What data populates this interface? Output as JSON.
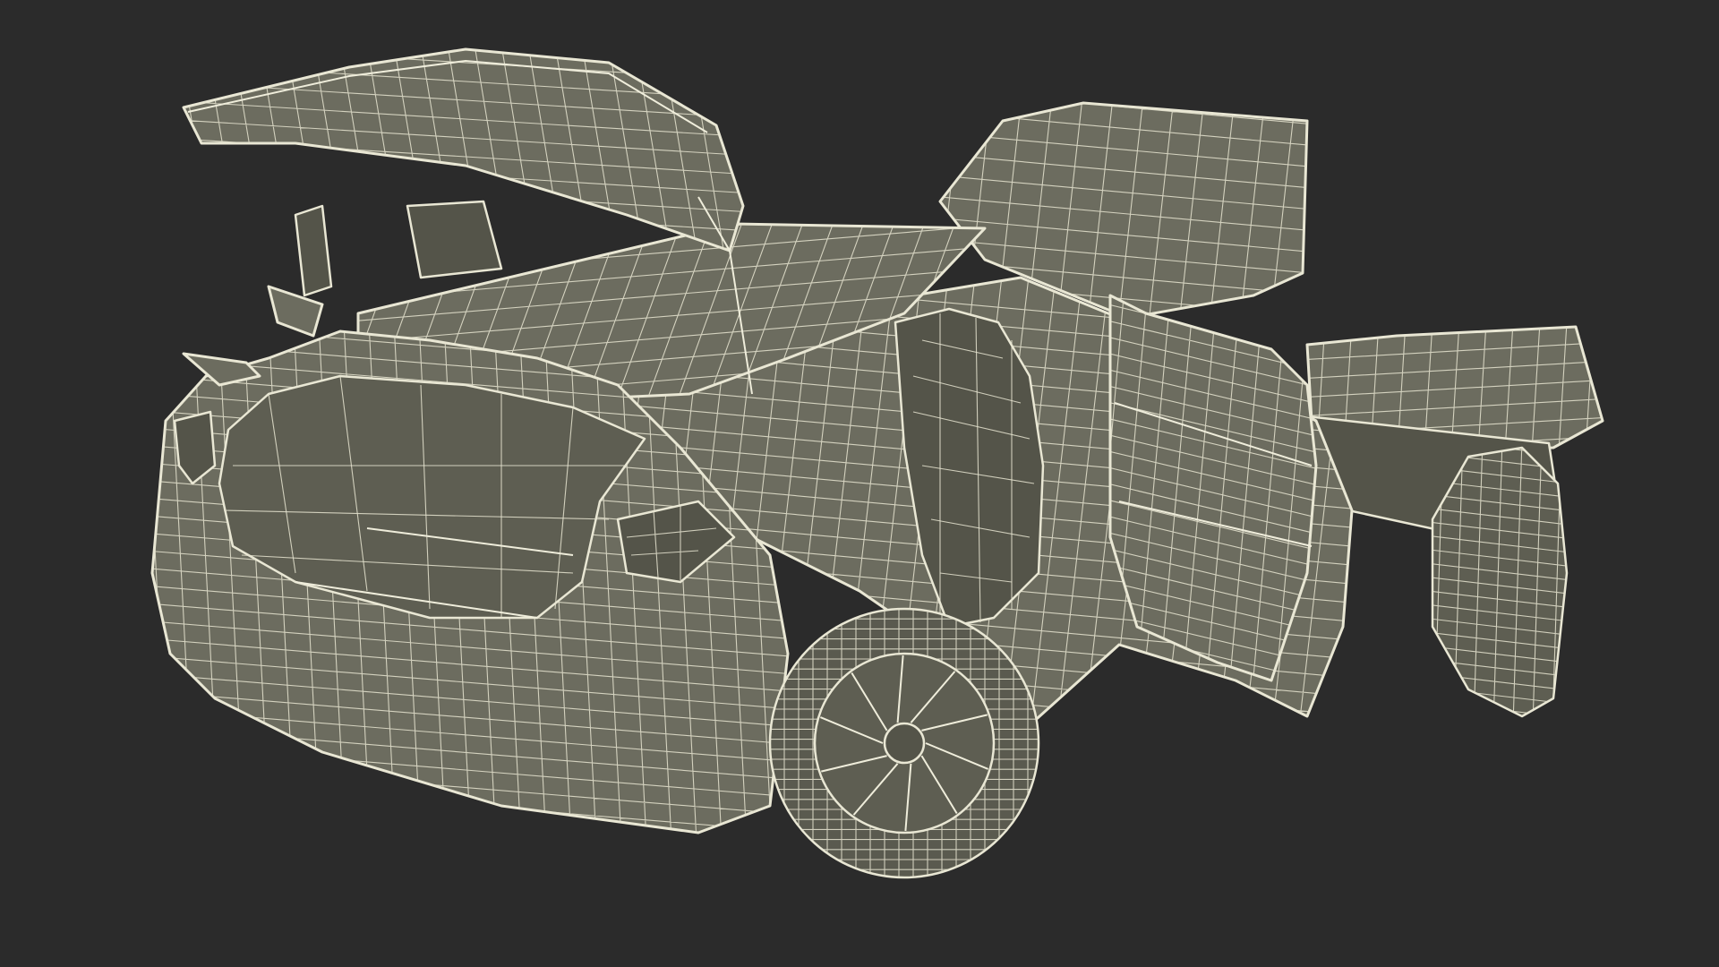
{
  "scene": {
    "subject": "car-wireframe-model",
    "background_color": "#2b2b2b",
    "mesh_fill_color": "#6c6c5f",
    "wire_color": "#e9e7d4",
    "open_parts": [
      "tailgate",
      "front-left-door",
      "rear-left-door",
      "front-right-door"
    ]
  }
}
